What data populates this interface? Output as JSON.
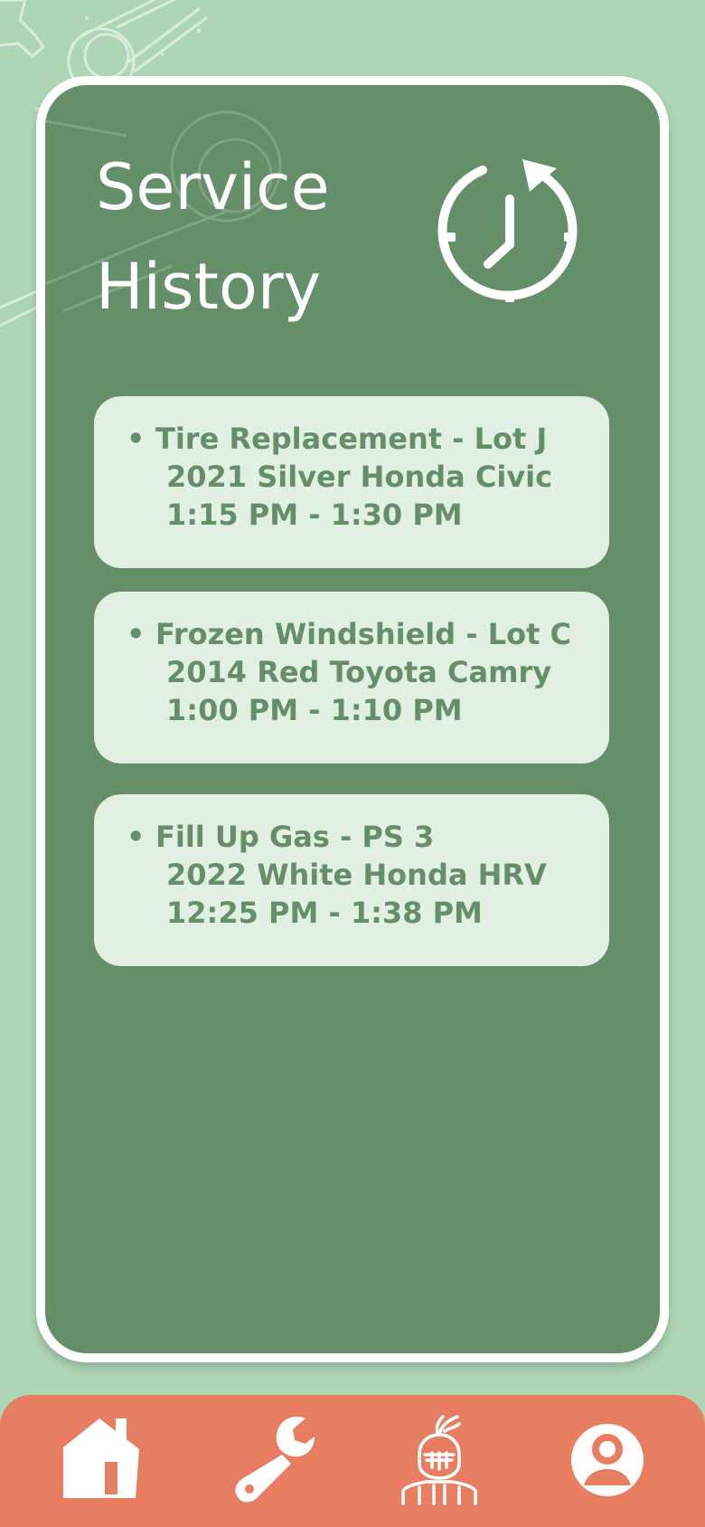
{
  "screen": {
    "title": "Service\nHistory",
    "history_icon": "clock-refresh-icon"
  },
  "entries": [
    {
      "line1": "Tire Replacement - Lot J",
      "line2": "2021 Silver Honda Civic",
      "line3": "1:15 PM - 1:30 PM"
    },
    {
      "line1": "Frozen Windshield - Lot C",
      "line2": "2014 Red Toyota Camry",
      "line3": "1:00 PM - 1:10 PM"
    },
    {
      "line1": "Fill Up Gas - PS 3",
      "line2": "2022 White Honda HRV",
      "line3": "12:25 PM - 1:38 PM"
    }
  ],
  "bullet": "•",
  "nav": {
    "items": [
      {
        "icon": "home-icon"
      },
      {
        "icon": "wrench-icon"
      },
      {
        "icon": "knight-icon"
      },
      {
        "icon": "profile-icon"
      }
    ]
  },
  "colors": {
    "background": "#aed6b5",
    "card": "#648f68",
    "entry_bg": "#e2efe3",
    "entry_text": "#648f68",
    "nav": "#e77e62",
    "white": "#ffffff"
  }
}
